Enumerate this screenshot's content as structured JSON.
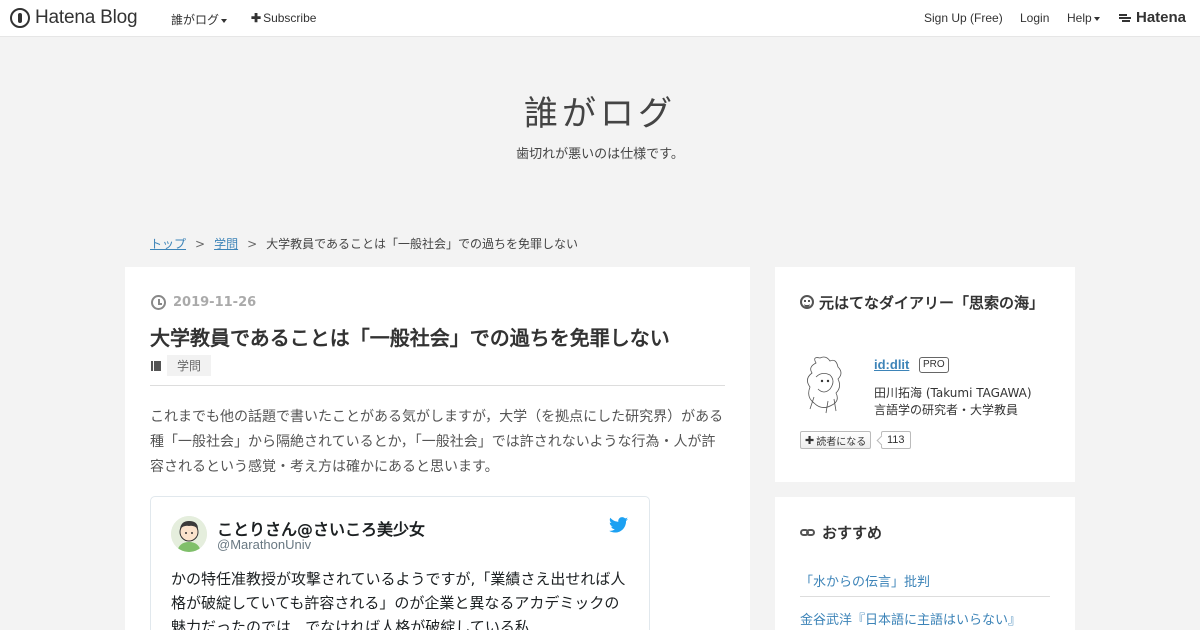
{
  "globalbar": {
    "logo_text": "Hatena Blog",
    "blog_menu": "誰がログ",
    "subscribe": "Subscribe",
    "signup": "Sign Up (Free)",
    "login": "Login",
    "help": "Help",
    "hatena": "Hatena"
  },
  "header": {
    "title": "誰がログ",
    "description": "歯切れが悪いのは仕様です。"
  },
  "breadcrumb": {
    "top": "トップ",
    "category": "学問",
    "current": "大学教員であることは「一般社会」での過ちを免罪しない",
    "separator": ">"
  },
  "article": {
    "date": "2019-11-26",
    "title": "大学教員であることは「一般社会」での過ちを免罪しない",
    "category": "学問",
    "body": "これまでも他の話題で書いたことがある気がしますが，大学（を拠点にした研究界）がある種「一般社会」から隔絶されているとか，「一般社会」では許されないような行為・人が許容されるという感覚・考え方は確かにあると思います。"
  },
  "tweet": {
    "name": "ことりさん@さいころ美少女",
    "handle": "@MarathonUniv",
    "text": "かの特任准教授が攻撃されているようですが,「業績さえ出せれば人格が破綻していても許容される」のが企業と異なるアカデミックの魅力だったのでは...でなければ人格が破綻している私"
  },
  "sidebar": {
    "profile": {
      "title": "元はてなダイアリー「思索の海」",
      "id": "id:dlit",
      "badge": "PRO",
      "name": "田川拓海 (Takumi TAGAWA)",
      "bio": "言語学の研究者・大学教員",
      "subscribe_label": "読者になる",
      "subscriber_count": "113"
    },
    "recommend": {
      "title": "おすすめ",
      "items": [
        "「水からの伝言」批判",
        "金谷武洋『日本語に主語はいらない』"
      ]
    }
  },
  "colors": {
    "link": "#3d84b8",
    "twitter": "#1da1f2",
    "background": "#f3f3f3"
  }
}
